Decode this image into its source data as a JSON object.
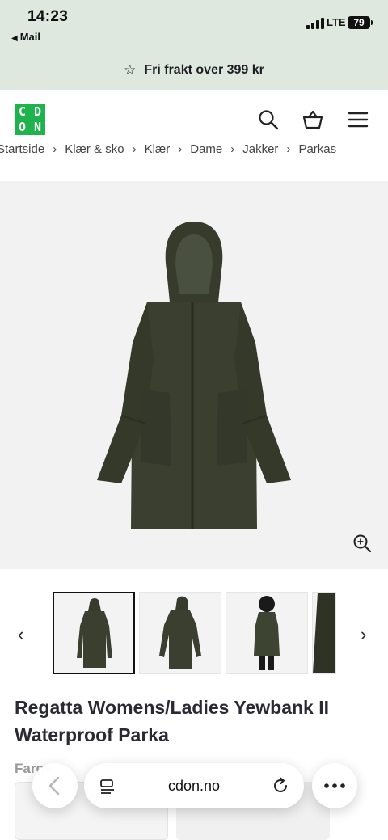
{
  "status_bar": {
    "time": "14:23",
    "back_app": "Mail",
    "network": "LTE",
    "battery": "79"
  },
  "promo": {
    "text": "Fri frakt over 399 kr",
    "icon": "star-icon"
  },
  "header": {
    "logo_letters": [
      "C",
      "D",
      "O",
      "N"
    ],
    "brand_color": "#1fb34d",
    "icons": [
      "search-icon",
      "basket-icon",
      "menu-icon"
    ]
  },
  "breadcrumb": {
    "items": [
      "Startside",
      "Klær & sko",
      "Klær",
      "Dame",
      "Jakker",
      "Parkas"
    ]
  },
  "product": {
    "title": "Regatta Womens/Ladies Yewbank II Waterproof Parka",
    "color_label": "Farge",
    "coat_color": "#3a3f2f",
    "thumbnail_count": 4,
    "selected_thumbnail": 0
  },
  "browser": {
    "url": "cdon.no"
  }
}
